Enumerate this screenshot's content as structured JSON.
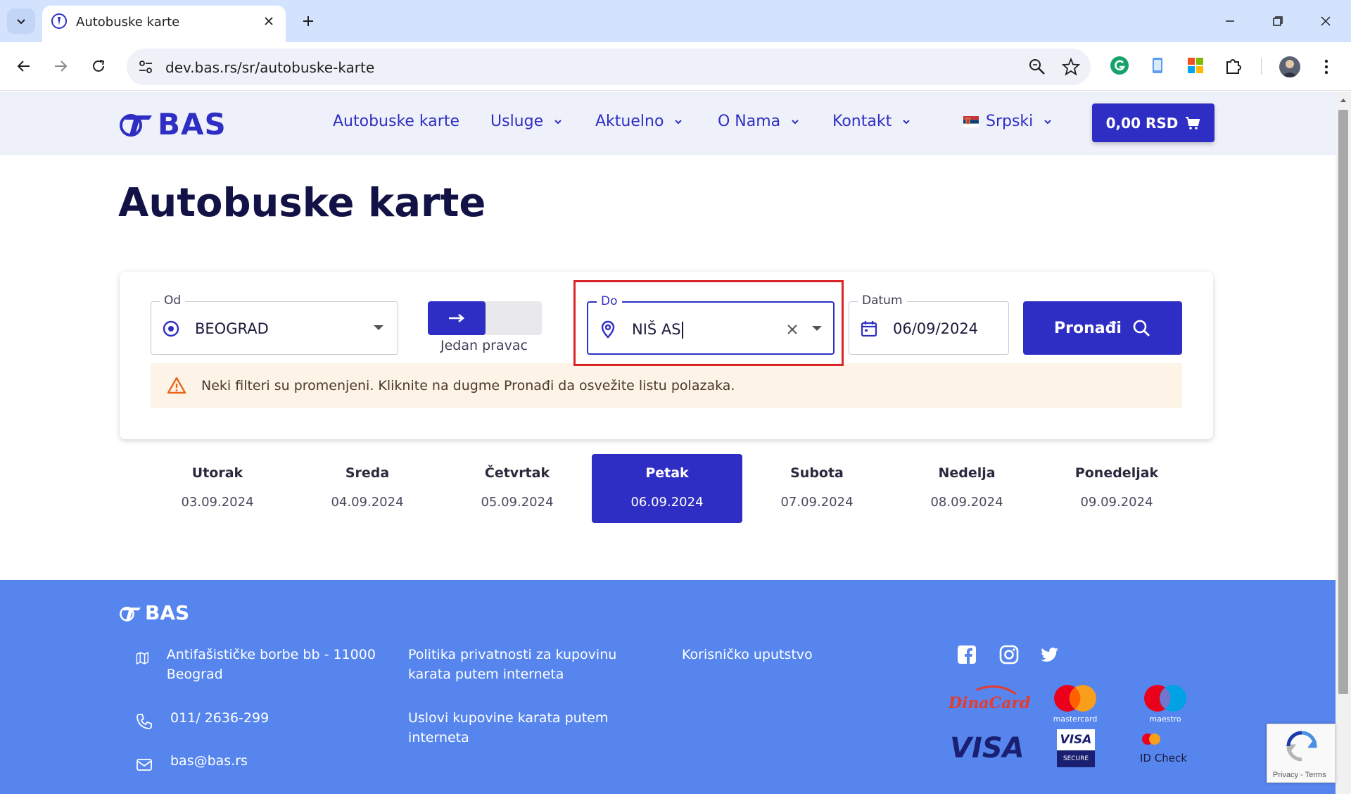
{
  "browser": {
    "tab_title": "Autobuske karte",
    "url": "dev.bas.rs/sr/autobuske-karte"
  },
  "header": {
    "logo_text": "BAS",
    "nav": [
      {
        "label": "Autobuske karte"
      },
      {
        "label": "Usluge"
      },
      {
        "label": "Aktuelno"
      },
      {
        "label": "O Nama"
      },
      {
        "label": "Kontakt"
      }
    ],
    "language": "Srpski",
    "cart": "0,00 RSD"
  },
  "page": {
    "title": "Autobuske karte"
  },
  "search": {
    "from_label": "Od",
    "from_value": "BEOGRAD",
    "direction_label": "Jedan pravac",
    "to_label": "Do",
    "to_value": "NIŠ AS",
    "date_label": "Datum",
    "date_value": "06/09/2024",
    "button": "Pronađi",
    "notice": "Neki filteri su promenjeni. Kliknite na dugme Pronađi da osvežite listu polazaka."
  },
  "days": [
    {
      "name": "Utorak",
      "date": "03.09.2024"
    },
    {
      "name": "Sreda",
      "date": "04.09.2024"
    },
    {
      "name": "Četvrtak",
      "date": "05.09.2024"
    },
    {
      "name": "Petak",
      "date": "06.09.2024"
    },
    {
      "name": "Subota",
      "date": "07.09.2024"
    },
    {
      "name": "Nedelja",
      "date": "08.09.2024"
    },
    {
      "name": "Ponedeljak",
      "date": "09.09.2024"
    }
  ],
  "selected_day_index": 3,
  "footer": {
    "logo_text": "BAS",
    "address": "Antifašističke borbe bb - 11000 Beograd",
    "phone": "011/ 2636-299",
    "email": "bas@bas.rs",
    "link_privacy": "Politika privatnosti za kupovinu karata putem interneta",
    "link_terms": "Uslovi kupovine karata putem interneta",
    "link_manual": "Korisničko uputstvo",
    "pay_dinacard": "DinaCard",
    "pay_mastercard": "mastercard",
    "pay_maestro": "maestro",
    "pay_visa": "VISA",
    "pay_visa_secure_top": "VISA",
    "pay_visa_secure_bottom": "SECURE",
    "pay_idcheck": "ID Check"
  },
  "recaptcha": {
    "links": "Privacy - Terms"
  },
  "colors": {
    "brand": "#2f2ec4",
    "footer": "#5685ee",
    "highlight": "#d9262a"
  }
}
